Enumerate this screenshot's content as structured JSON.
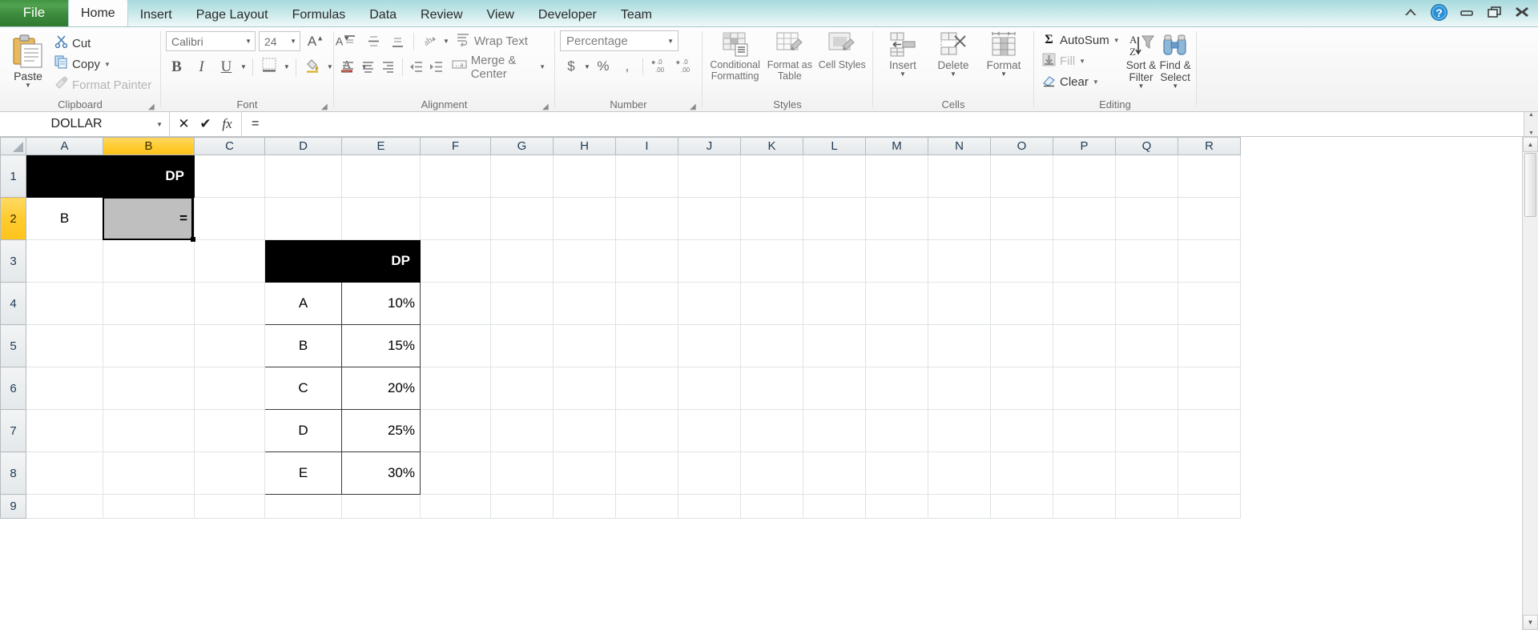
{
  "window": {
    "controls": [
      {
        "name": "ribbon-collapse",
        "glyph": "⌃"
      },
      {
        "name": "help",
        "glyph": "?"
      },
      {
        "name": "minimize",
        "glyph": "–"
      },
      {
        "name": "restore",
        "glyph": "❐"
      },
      {
        "name": "close",
        "glyph": "✕"
      }
    ]
  },
  "tabs": {
    "file_label": "File",
    "items": [
      {
        "label": "Home",
        "active": true
      },
      {
        "label": "Insert",
        "active": false
      },
      {
        "label": "Page Layout",
        "active": false
      },
      {
        "label": "Formulas",
        "active": false
      },
      {
        "label": "Data",
        "active": false
      },
      {
        "label": "Review",
        "active": false
      },
      {
        "label": "View",
        "active": false
      },
      {
        "label": "Developer",
        "active": false
      },
      {
        "label": "Team",
        "active": false
      }
    ]
  },
  "ribbon": {
    "clipboard": {
      "group_label": "Clipboard",
      "paste_label": "Paste",
      "cut_label": "Cut",
      "copy_label": "Copy",
      "format_painter_label": "Format Painter"
    },
    "font": {
      "group_label": "Font",
      "font_name": "Calibri",
      "font_size": "24",
      "bold_label": "B",
      "italic_label": "I",
      "underline_label": "U"
    },
    "alignment": {
      "group_label": "Alignment",
      "wrap_text_label": "Wrap Text",
      "merge_center_label": "Merge & Center"
    },
    "number": {
      "group_label": "Number",
      "format_value": "Percentage",
      "currency_label": "$",
      "percent_label": "%",
      "comma_label": ",",
      "increase_decimal_label": ".0",
      "decrease_decimal_label": ".00"
    },
    "styles": {
      "group_label": "Styles",
      "conditional_formatting_label": "Conditional Formatting",
      "format_as_table_label": "Format as Table",
      "cell_styles_label": "Cell Styles"
    },
    "cells": {
      "group_label": "Cells",
      "insert_label": "Insert",
      "delete_label": "Delete",
      "format_label": "Format"
    },
    "editing": {
      "group_label": "Editing",
      "autosum_label": "AutoSum",
      "fill_label": "Fill",
      "clear_label": "Clear",
      "sort_filter_label": "Sort & Filter",
      "find_select_label": "Find & Select"
    }
  },
  "formula_bar": {
    "name_box_value": "DOLLAR",
    "cancel_glyph": "✕",
    "enter_glyph": "✔",
    "function_glyph": "fx",
    "formula_value": "="
  },
  "sheet": {
    "columns": [
      "A",
      "B",
      "C",
      "D",
      "E",
      "F",
      "G",
      "H",
      "I",
      "J",
      "K",
      "L",
      "M",
      "N",
      "O",
      "P",
      "Q",
      "R"
    ],
    "selected_column": "B",
    "rows": [
      "1",
      "2",
      "3",
      "4",
      "5",
      "6",
      "7",
      "8",
      "9"
    ],
    "selected_row": "2",
    "active_cell": "B2",
    "cells": {
      "A1_B1_merged_header": "DP",
      "A2": "B",
      "B2_editing": "=",
      "D3_E3_merged_header": "DP",
      "D4": "A",
      "E4": "10%",
      "D5": "B",
      "E5": "15%",
      "D6": "C",
      "E6": "20%",
      "D7": "D",
      "E7": "25%",
      "D8": "E",
      "E8": "30%"
    },
    "lookup_table": {
      "header": "DP",
      "rows": [
        {
          "grade": "A",
          "percent": "10%"
        },
        {
          "grade": "B",
          "percent": "15%"
        },
        {
          "grade": "C",
          "percent": "20%"
        },
        {
          "grade": "D",
          "percent": "25%"
        },
        {
          "grade": "E",
          "percent": "30%"
        }
      ]
    }
  },
  "colors": {
    "file_tab_green": "#3d8b3d",
    "titlebar_cyan": "#a8dadd",
    "header_selected_yellow": "#ffcb2f",
    "table_header_black": "#000000",
    "editing_cell_gray": "#bfbfbf"
  }
}
